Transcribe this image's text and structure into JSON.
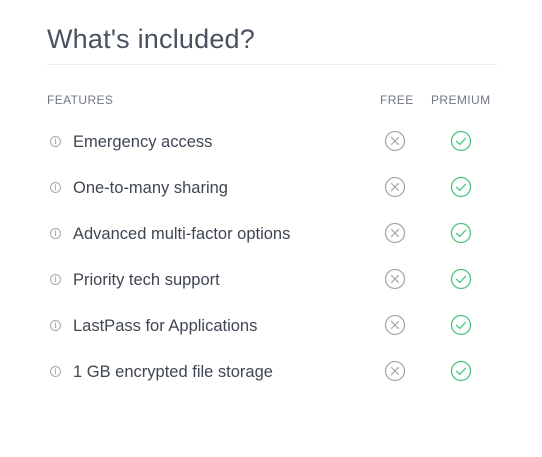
{
  "title": "What's included?",
  "columns": {
    "features": "FEATURES",
    "free": "FREE",
    "premium": "PREMIUM"
  },
  "colors": {
    "free_icon": "#a5a9b0",
    "premium_icon": "#4cc47f"
  },
  "rows": [
    {
      "label": "Emergency access",
      "info_icon": "i",
      "free": "not-included",
      "premium": "included"
    },
    {
      "label": "One-to-many sharing",
      "info_icon": "i",
      "free": "not-included",
      "premium": "included"
    },
    {
      "label": "Advanced multi-factor options",
      "info_icon": "i",
      "free": "not-included",
      "premium": "included"
    },
    {
      "label": "Priority tech support",
      "info_icon": "i",
      "free": "not-included",
      "premium": "included"
    },
    {
      "label": "LastPass for Applications",
      "info_icon": "i",
      "free": "not-included",
      "premium": "included"
    },
    {
      "label": "1 GB encrypted file storage",
      "info_icon": "i",
      "free": "not-included",
      "premium": "included"
    }
  ]
}
